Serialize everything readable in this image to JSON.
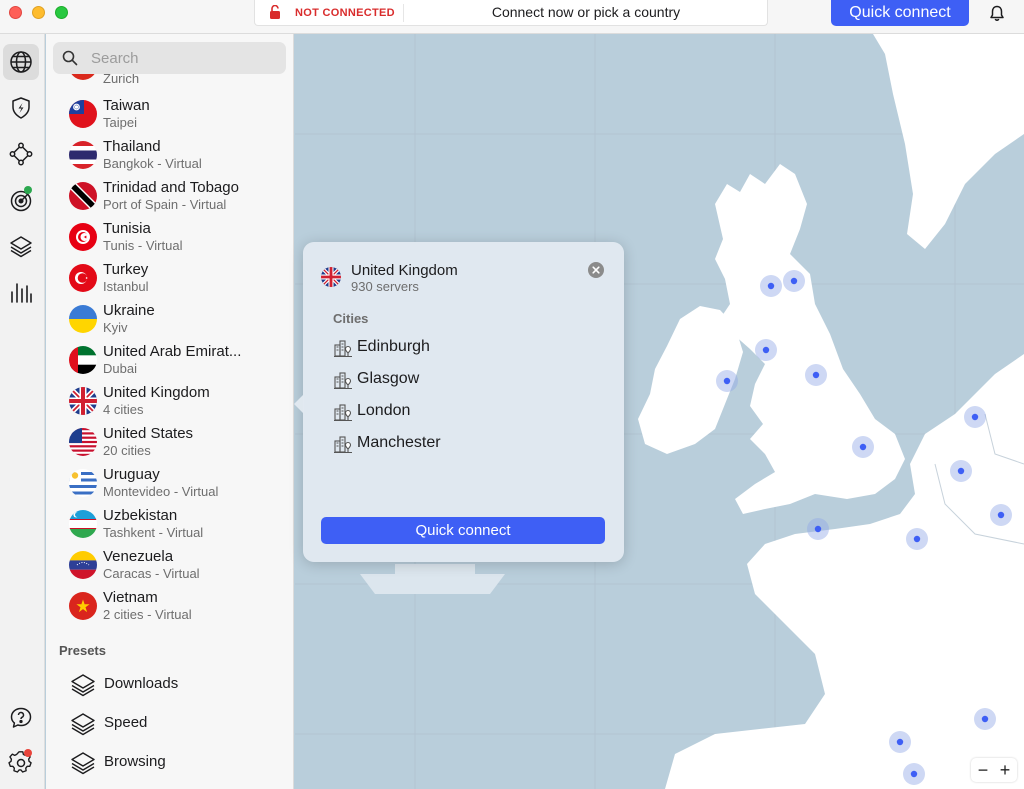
{
  "titlebar": {
    "status": "NOT CONNECTED",
    "prompt": "Connect now or pick a country",
    "quick_connect": "Quick connect"
  },
  "colors": {
    "accent": "#3e5ff5",
    "danger": "#d92c2c",
    "map_sea": "#b9cedb",
    "map_land": "#ffffff",
    "server_dot": "#3e5ff5"
  },
  "rail": {
    "items": [
      {
        "icon": "globe-icon",
        "active": true
      },
      {
        "icon": "shield-bolt-icon"
      },
      {
        "icon": "meshnet-icon"
      },
      {
        "icon": "target-icon",
        "badge": "green"
      },
      {
        "icon": "layers-icon"
      },
      {
        "icon": "stats-icon"
      }
    ],
    "bottom": [
      {
        "icon": "help-icon"
      },
      {
        "icon": "settings-icon",
        "badge": "red"
      }
    ]
  },
  "search": {
    "placeholder": "Search"
  },
  "countries": {
    "cut_sub": "Zurich",
    "items": [
      {
        "name": "Taiwan",
        "sub": "Taipei"
      },
      {
        "name": "Thailand",
        "sub": "Bangkok - Virtual"
      },
      {
        "name": "Trinidad and Tobago",
        "sub": "Port of Spain - Virtual"
      },
      {
        "name": "Tunisia",
        "sub": "Tunis - Virtual"
      },
      {
        "name": "Turkey",
        "sub": "Istanbul"
      },
      {
        "name": "Ukraine",
        "sub": "Kyiv"
      },
      {
        "name": "United Arab Emirat...",
        "sub": "Dubai"
      },
      {
        "name": "United Kingdom",
        "sub": "4 cities"
      },
      {
        "name": "United States",
        "sub": "20 cities"
      },
      {
        "name": "Uruguay",
        "sub": "Montevideo - Virtual"
      },
      {
        "name": "Uzbekistan",
        "sub": "Tashkent - Virtual"
      },
      {
        "name": "Venezuela",
        "sub": "Caracas - Virtual"
      },
      {
        "name": "Vietnam",
        "sub": "2 cities - Virtual"
      }
    ]
  },
  "presets": {
    "title": "Presets",
    "items": [
      {
        "label": "Downloads"
      },
      {
        "label": "Speed"
      },
      {
        "label": "Browsing"
      }
    ]
  },
  "popup": {
    "country": "United Kingdom",
    "servers": "930 servers",
    "cities_title": "Cities",
    "cities": [
      "Edinburgh",
      "Glasgow",
      "London",
      "Manchester"
    ],
    "quick_connect": "Quick connect"
  },
  "zoom": {
    "minus": "−",
    "plus": "+"
  }
}
